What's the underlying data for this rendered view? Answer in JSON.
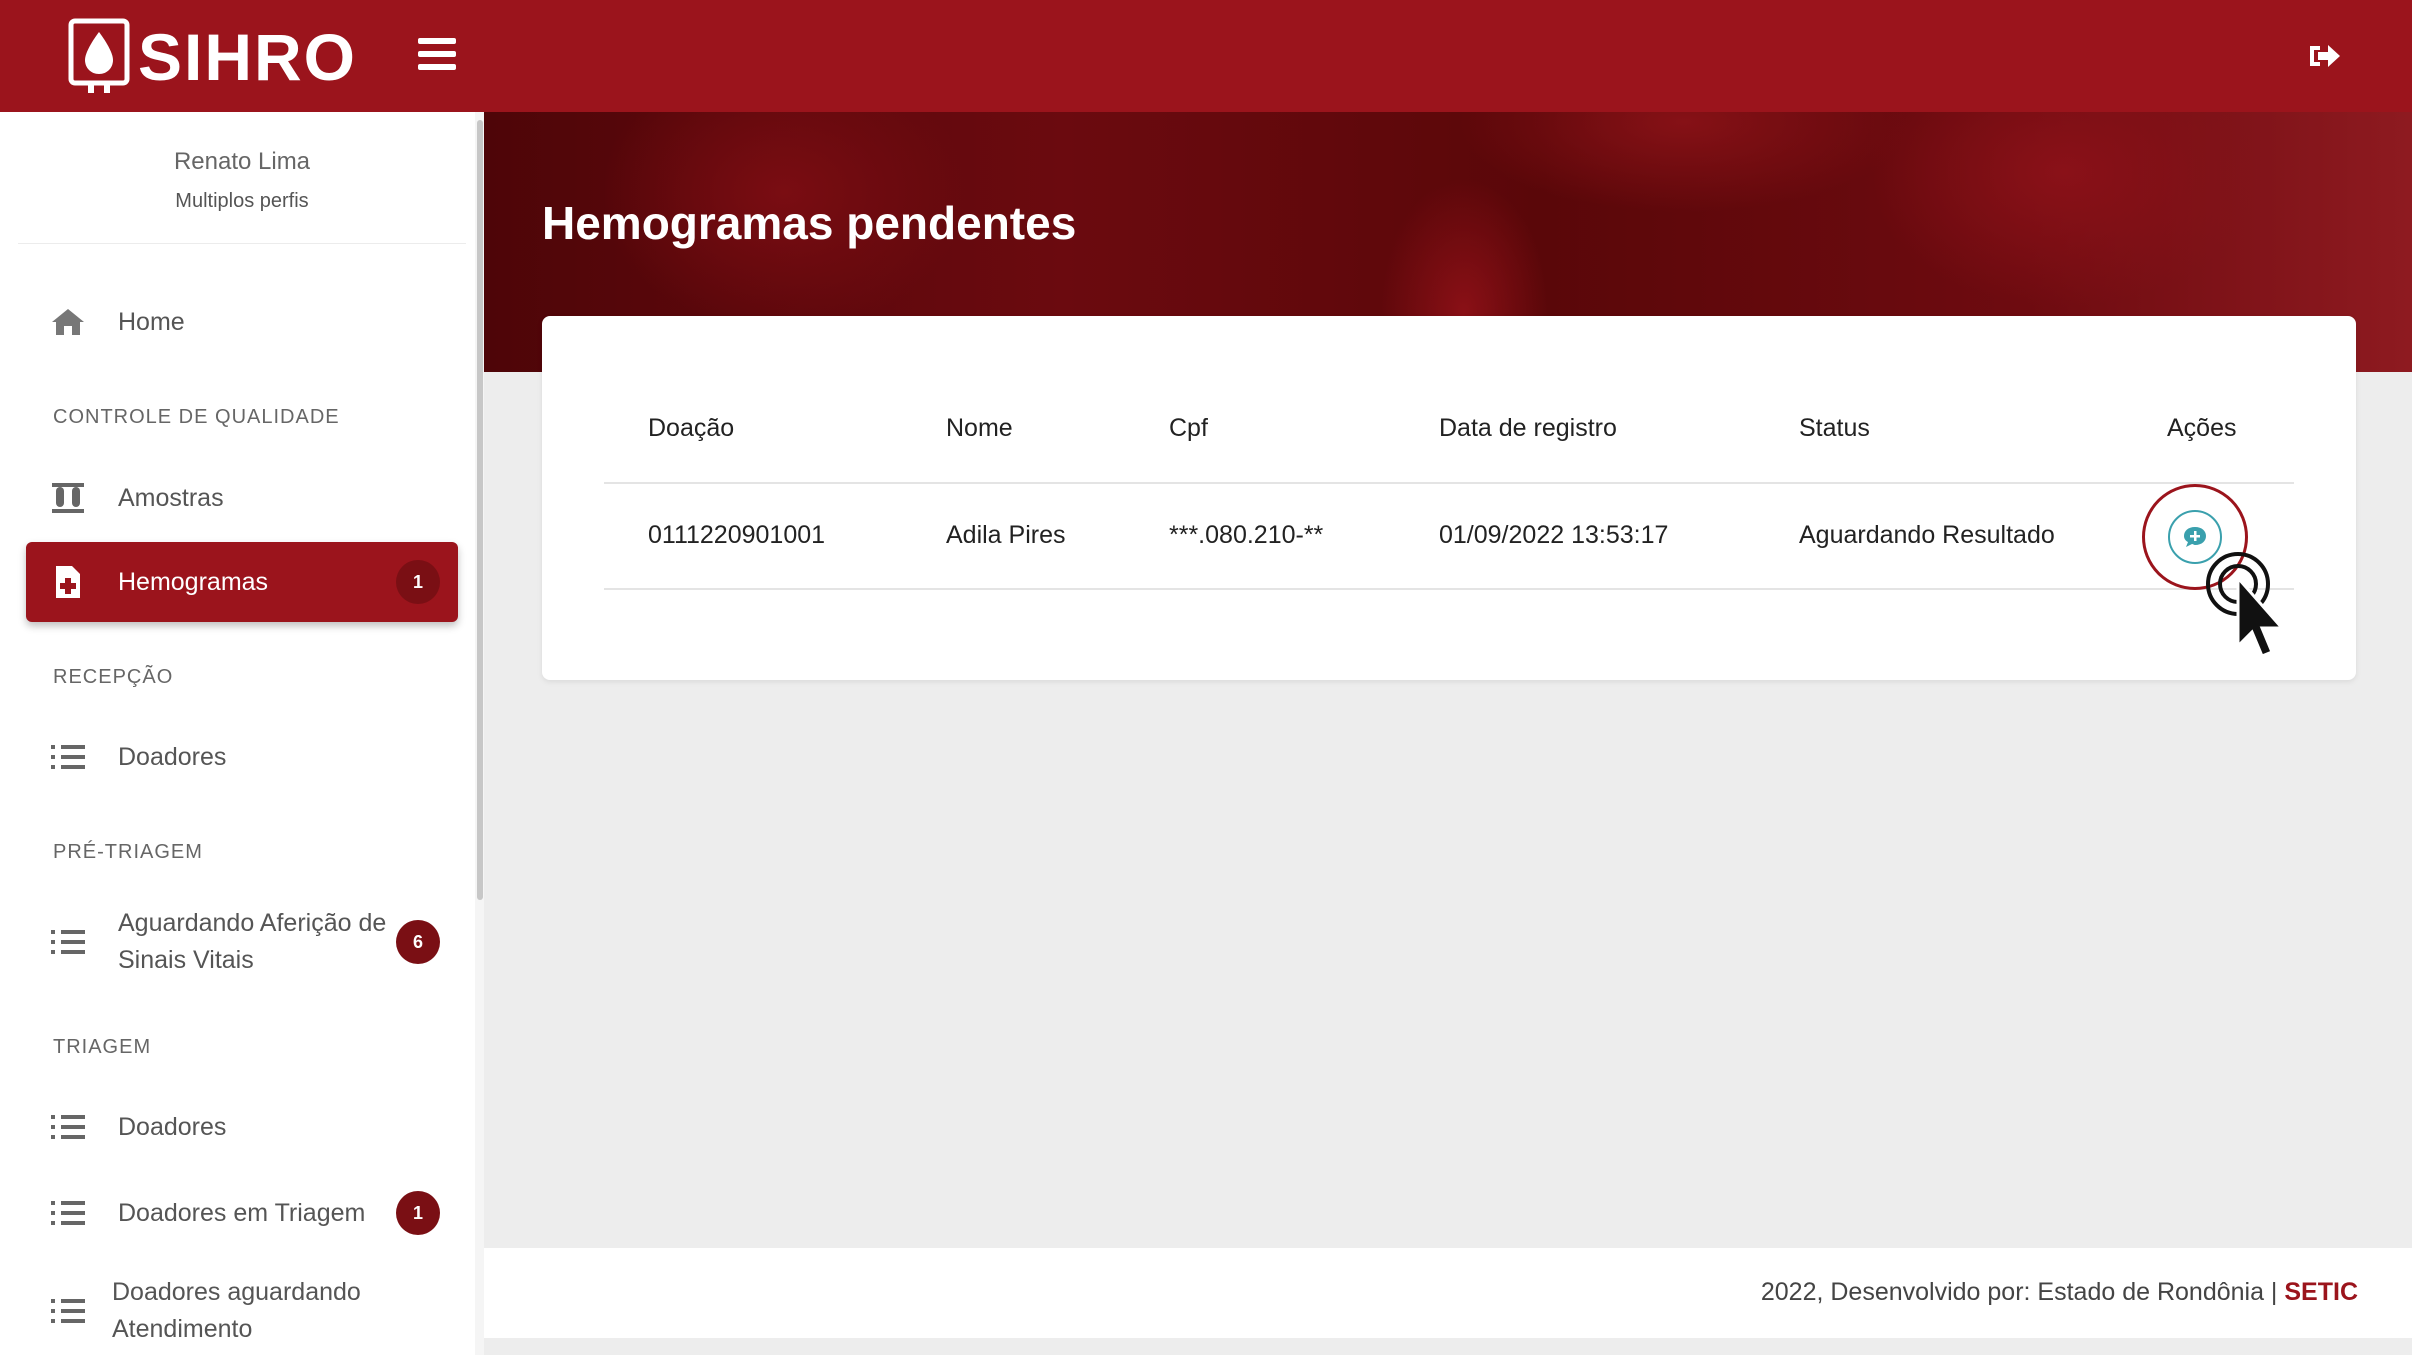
{
  "app": {
    "name": "SIHRO"
  },
  "user": {
    "name": "Renato Lima",
    "role": "Multiplos perfis"
  },
  "sidebar": {
    "home": "Home",
    "sections": [
      "CONTROLE DE QUALIDADE",
      "RECEPÇÃO",
      "PRÉ-TRIAGEM",
      "TRIAGEM"
    ],
    "items": [
      {
        "label": "Amostras",
        "icon": "test-tubes-icon"
      },
      {
        "label": "Hemogramas",
        "icon": "medical-file-icon",
        "badge": "1",
        "active": true
      },
      {
        "label": "Doadores",
        "icon": "ordered-list-icon"
      },
      {
        "label": "Aguardando Aferição de Sinais Vitais",
        "icon": "ordered-list-icon",
        "badge": "6"
      },
      {
        "label": "Doadores",
        "icon": "ordered-list-icon"
      },
      {
        "label": "Doadores em Triagem",
        "icon": "ordered-list-icon",
        "badge": "1"
      },
      {
        "label": "Doadores aguardando Atendimento",
        "icon": "ordered-list-icon"
      }
    ]
  },
  "page": {
    "title": "Hemogramas pendentes"
  },
  "table": {
    "headers": [
      "Doação",
      "Nome",
      "Cpf",
      "Data de registro",
      "Status",
      "Ações"
    ],
    "rows": [
      [
        "0111220901001",
        "Adila Pires",
        "***.080.210-**",
        "01/09/2022 13:53:17",
        "Aguardando Resultado"
      ]
    ]
  },
  "footer": {
    "text": "2022, Desenvolvido por: Estado de Rondônia | ",
    "link": "SETIC"
  },
  "colors": {
    "brand": "#9b141c",
    "badge": "#7a0f14",
    "action": "#3aa0ad"
  }
}
